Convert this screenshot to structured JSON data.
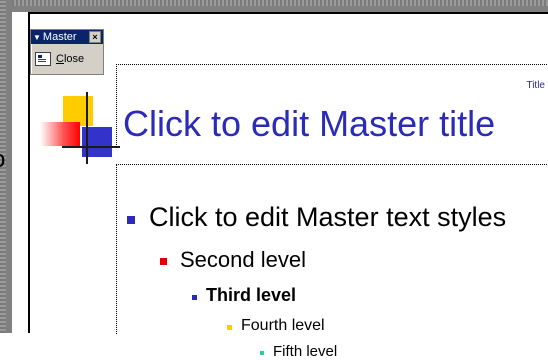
{
  "toolbar": {
    "title": "Master",
    "close_label_first": "C",
    "close_label_rest": "lose"
  },
  "slide": {
    "title_tag": "Title",
    "title_text": "Click to edit Master title",
    "edge_char": "o",
    "levels": [
      "Click to edit Master text styles",
      "Second level",
      "Third level",
      "Fourth level",
      "Fifth level"
    ]
  },
  "colors": {
    "title": "#2b2bb8",
    "bullet_l1": "#2b2bb8",
    "bullet_l2": "#e00000",
    "bullet_l3": "#2b2bb8",
    "bullet_l4": "#ffcc00",
    "bullet_l5": "#33cc99",
    "toolbar_titlebar": "#0a246a"
  }
}
